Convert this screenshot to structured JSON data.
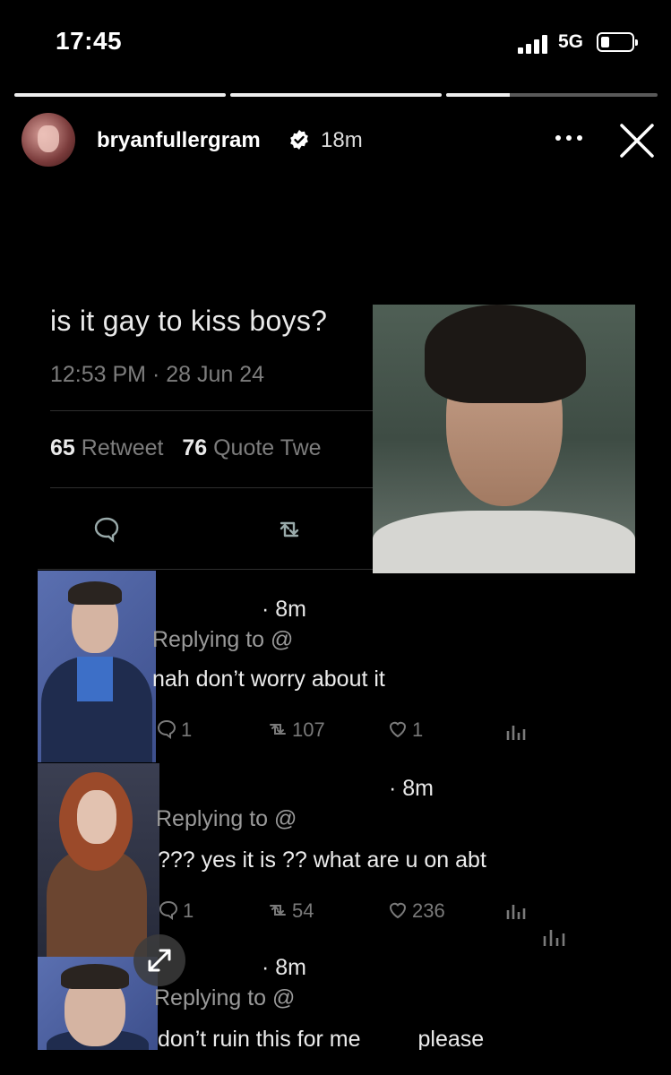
{
  "status_bar": {
    "time": "17:45",
    "network": "5G",
    "signal_bars": 4,
    "battery_level": 0.25
  },
  "story_progress": {
    "segments": [
      1,
      1,
      0.3
    ]
  },
  "header": {
    "username": "bryanfullergram",
    "verified": true,
    "time_ago": "18m"
  },
  "tweet": {
    "text": "is it gay to kiss boys?",
    "timestamp": "12:53 PM · 28 Jun 24",
    "retweets_count": "65",
    "retweets_label": "Retweet",
    "quotes_count": "76",
    "quotes_label": "Quote Twe"
  },
  "replies": [
    {
      "time": "· 8m",
      "replying": "Replying to @",
      "text": "nah don’t worry about it",
      "replies_count": "1",
      "retweets_count": "107",
      "likes_count": "1"
    },
    {
      "time": "· 8m",
      "replying": "Replying to @",
      "text": "??? yes it is ?? what are u on abt",
      "replies_count": "1",
      "retweets_count": "54",
      "likes_count": "236"
    },
    {
      "time": "· 8m",
      "replying": "Replying to @",
      "text": "don’t ruin this for me",
      "text_extra": "please"
    }
  ],
  "icons": {
    "more": "more-icon",
    "close": "close-icon",
    "expand": "expand-icon",
    "verified": "verified-badge-icon"
  }
}
